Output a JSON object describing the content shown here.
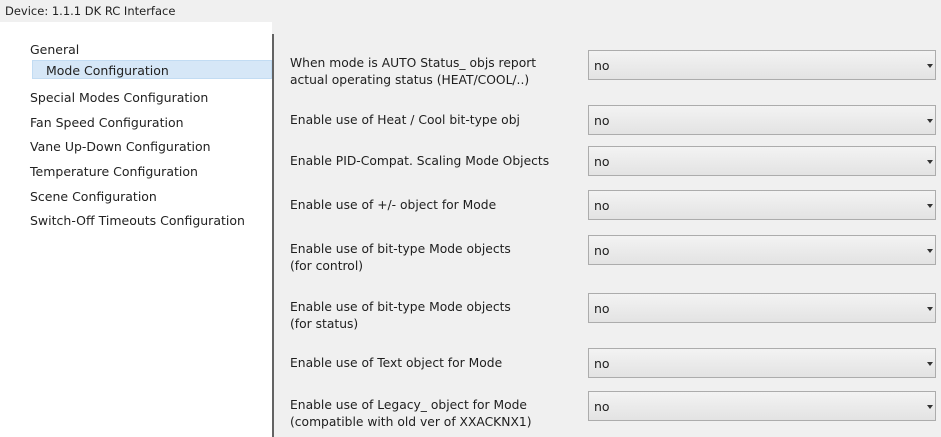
{
  "window": {
    "title": "Device: 1.1.1  DK RC Interface"
  },
  "sidebar": {
    "items": [
      {
        "label": "General"
      },
      {
        "label": "Mode Configuration",
        "selected": true
      },
      {
        "label": "Special Modes Configuration"
      },
      {
        "label": "Fan Speed Configuration"
      },
      {
        "label": "Vane Up-Down Configuration"
      },
      {
        "label": "Temperature Configuration"
      },
      {
        "label": "Scene Configuration"
      },
      {
        "label": "Switch-Off Timeouts Configuration"
      }
    ]
  },
  "params": [
    {
      "label_line1": "When mode is AUTO Status_ objs report",
      "label_line2": "actual operating status (HEAT/COOL/..)",
      "value": "no"
    },
    {
      "label_line1": "Enable use of Heat / Cool bit-type obj",
      "label_line2": "",
      "value": "no"
    },
    {
      "label_line1": "Enable PID-Compat. Scaling Mode Objects",
      "label_line2": "",
      "value": "no"
    },
    {
      "label_line1": "Enable use of +/- object for Mode",
      "label_line2": "",
      "value": "no"
    },
    {
      "label_line1": "Enable use of bit-type Mode objects",
      "label_line2": "(for control)",
      "value": "no"
    },
    {
      "label_line1": "Enable use of bit-type Mode objects",
      "label_line2": "(for status)",
      "value": "no"
    },
    {
      "label_line1": "Enable use of Text object for Mode",
      "label_line2": "",
      "value": "no"
    },
    {
      "label_line1": "Enable use of Legacy_ object for Mode",
      "label_line2": "(compatible with old ver of XXACKNX1)",
      "value": "no"
    }
  ]
}
